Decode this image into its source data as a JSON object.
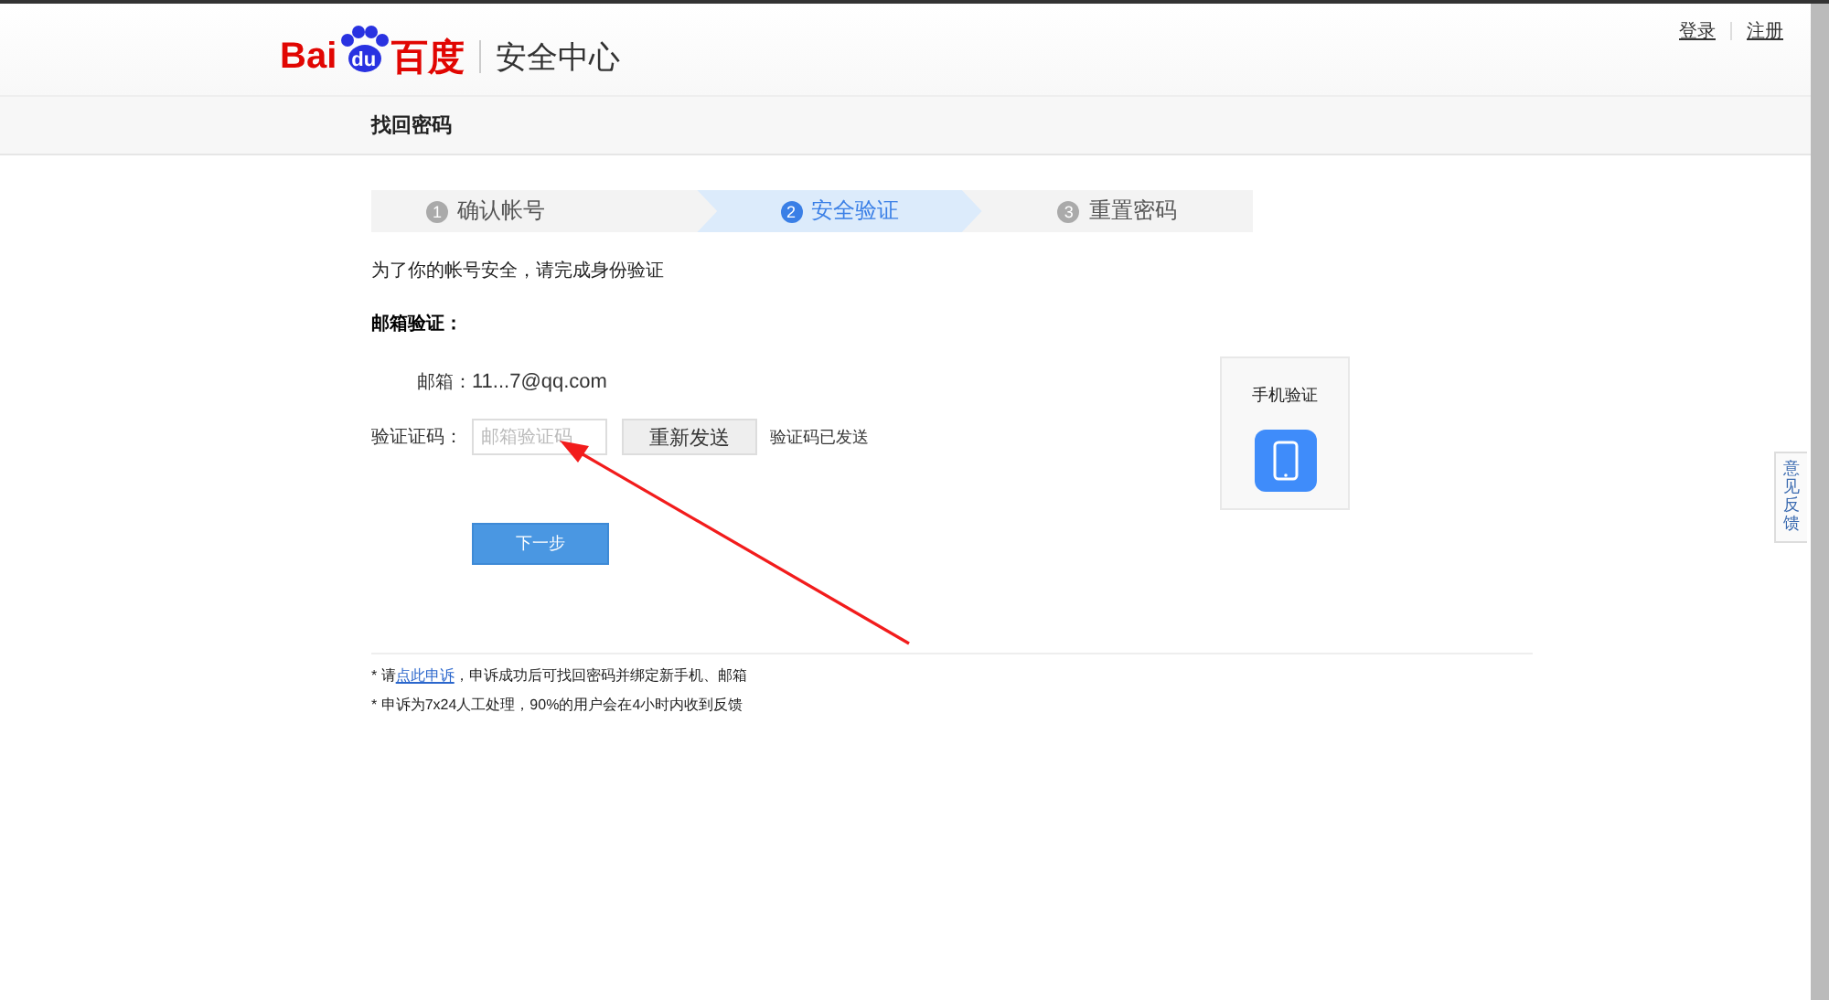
{
  "header": {
    "logo": {
      "left": "Bai",
      "paw": "du",
      "right": "百度"
    },
    "site_title": "安全中心",
    "links": [
      {
        "label": "登录"
      },
      {
        "label": "注册"
      }
    ]
  },
  "subnav": {
    "title": "找回密码"
  },
  "steps": [
    {
      "number": "1",
      "label": "确认帐号",
      "selected": false
    },
    {
      "number": "2",
      "label": "安全验证",
      "selected": true
    },
    {
      "number": "3",
      "label": "重置密码",
      "selected": false
    }
  ],
  "intro": "为了你的帐号安全，请完成身份验证",
  "section_title": "邮箱验证：",
  "email": {
    "label": "邮箱：",
    "value": "11...7@qq.com"
  },
  "code": {
    "label": "验证证码：",
    "placeholder": "邮箱验证码",
    "resend_button": "重新发送",
    "status": "验证码已发送"
  },
  "next_button": "下一步",
  "alt_method": {
    "title": "手机验证"
  },
  "notes": [
    {
      "marker": "*",
      "before": "请",
      "link": "点此申诉",
      "after": "，申诉成功后可找回密码并绑定新手机、邮箱"
    },
    {
      "marker": "*",
      "before": "申诉为7x24人工处理，90%的用户会在4小时内收到反馈"
    }
  ],
  "feedback_tab": "意见反馈"
}
